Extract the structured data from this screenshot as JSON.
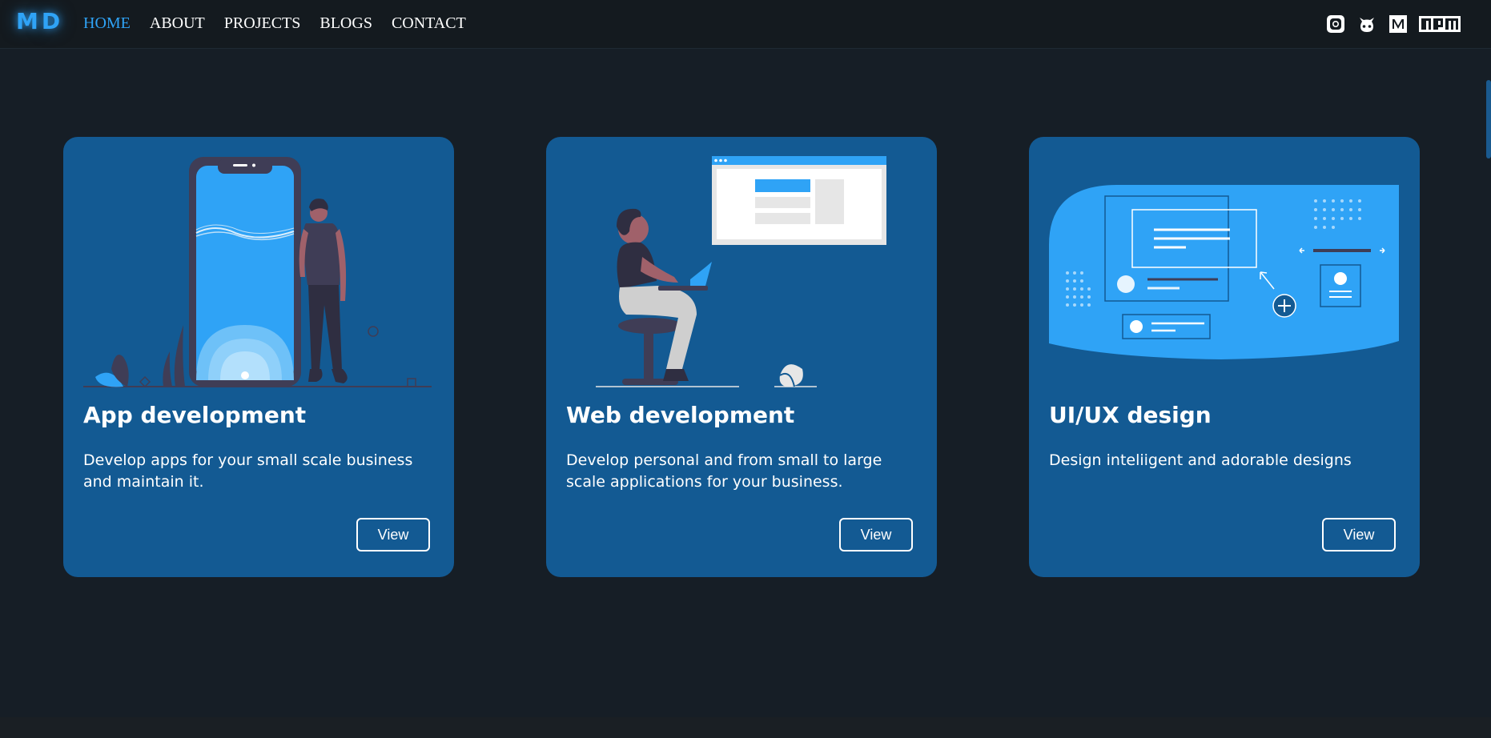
{
  "brand": {
    "logo": "MD"
  },
  "nav": {
    "links": [
      {
        "label": "HOME",
        "active": true
      },
      {
        "label": "ABOUT",
        "active": false
      },
      {
        "label": "PROJECTS",
        "active": false
      },
      {
        "label": "BLOGS",
        "active": false
      },
      {
        "label": "CONTACT",
        "active": false
      }
    ]
  },
  "socials": [
    {
      "icon": "instagram-icon"
    },
    {
      "icon": "github-icon"
    },
    {
      "icon": "medium-icon"
    },
    {
      "icon": "npm-icon"
    }
  ],
  "cards": [
    {
      "title": "App development",
      "description": "Develop apps for your small scale business and maintain it.",
      "button": "View"
    },
    {
      "title": "Web development",
      "description": "Develop personal and from small to large scale applications for your business.",
      "button": "View"
    },
    {
      "title": "UI/UX design",
      "description": "Design inteliigent and adorable designs",
      "button": "View"
    }
  ],
  "colors": {
    "accent": "#2fa3f6",
    "card": "#135a93",
    "background": "#161e26"
  }
}
